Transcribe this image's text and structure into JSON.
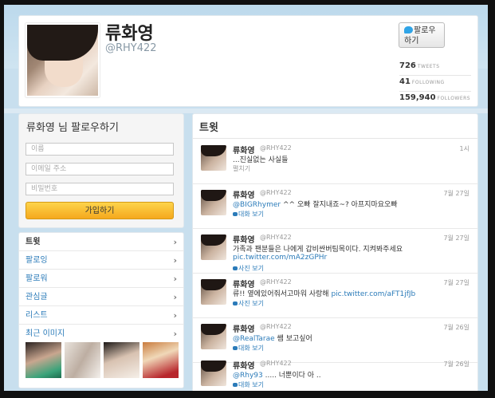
{
  "profile": {
    "name": "류화영",
    "handle": "@RHY422",
    "follow_label_line1": "팔로우",
    "follow_label_line2": "하기",
    "stats": [
      {
        "count": "726",
        "label": "TWEETS"
      },
      {
        "count": "41",
        "label": "FOLLOWING"
      },
      {
        "count": "159,940",
        "label": "FOLLOWERS"
      }
    ]
  },
  "signup": {
    "title": "류화영 님 팔로우하기",
    "name_placeholder": "이름",
    "email_placeholder": "이메일 주소",
    "password_placeholder": "비밀번호",
    "button": "가입하기"
  },
  "nav": {
    "items": [
      {
        "label": "트윗",
        "active": true
      },
      {
        "label": "팔로잉"
      },
      {
        "label": "팔로워"
      },
      {
        "label": "관심글"
      },
      {
        "label": "리스트"
      },
      {
        "label": "최근 이미지"
      }
    ]
  },
  "timeline": {
    "title": "트윗",
    "tweets": [
      {
        "name": "류화영",
        "handle": "@RHY422",
        "time": "1시",
        "text": "...진실없는 사실들",
        "action": "펼치기",
        "link": ""
      },
      {
        "name": "류화영",
        "handle": "@RHY422",
        "time": "7월 27일",
        "mention": "@BIGRhymer",
        "text": " ^^ 오빠 잘지내죠~? 아프지마요오빠",
        "action": "대화 보기"
      },
      {
        "name": "류화영",
        "handle": "@RHY422",
        "time": "7월 27일",
        "text": "가족과 팬분들은 나에게 갑비싼버팀목이다. 지켜봐주세요",
        "link": "pic.twitter.com/mA2zGPHr",
        "action": "사진 보기"
      },
      {
        "name": "류화영",
        "handle": "@RHY422",
        "time": "7월 27일",
        "text": "류!! 옆에있어줘서고마워 사랑해 ",
        "inline_link": "pic.twitter.com/aFT1jfJb",
        "action": "사진 보기"
      },
      {
        "name": "류화영",
        "handle": "@RHY422",
        "time": "7월 26일",
        "mention": "@RealTarae",
        "text": " 쌤 보고싶어",
        "action": "대화 보기"
      },
      {
        "name": "류화영",
        "handle": "@RHY422",
        "time": "7월 26일",
        "mention": "@Rhy93",
        "text": " ..... 너뿐이다 아 ..",
        "action": "대화 보기"
      }
    ]
  }
}
